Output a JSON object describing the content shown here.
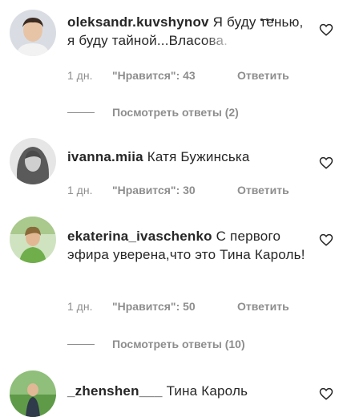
{
  "comments": [
    {
      "username": "oleksandr.kuvshynov",
      "text_main": "Я буду тенью, я буду тайной...Вла",
      "text_faded": "сова.",
      "more": "...",
      "time": "1 дн.",
      "likes": "\"Нравится\": 43",
      "reply": "Ответить",
      "view_replies": "Посмотреть ответы (2)"
    },
    {
      "username": "ivanna.miia",
      "text": "Катя Бужинська",
      "time": "1 дн.",
      "likes": "\"Нравится\": 30",
      "reply": "Ответить"
    },
    {
      "username": "ekaterina_ivaschenko",
      "text": "С первого эфира уверена,что это Тина Кароль!",
      "time": "1 дн.",
      "likes": "\"Нравится\": 50",
      "reply": "Ответить",
      "view_replies": "Посмотреть ответы (10)"
    },
    {
      "username": "_zhenshen___",
      "text": "Тина Кароль"
    }
  ],
  "icons": {
    "like": "heart-outline-icon"
  },
  "colors": {
    "text": "#262626",
    "secondary": "#8e8e8e"
  }
}
